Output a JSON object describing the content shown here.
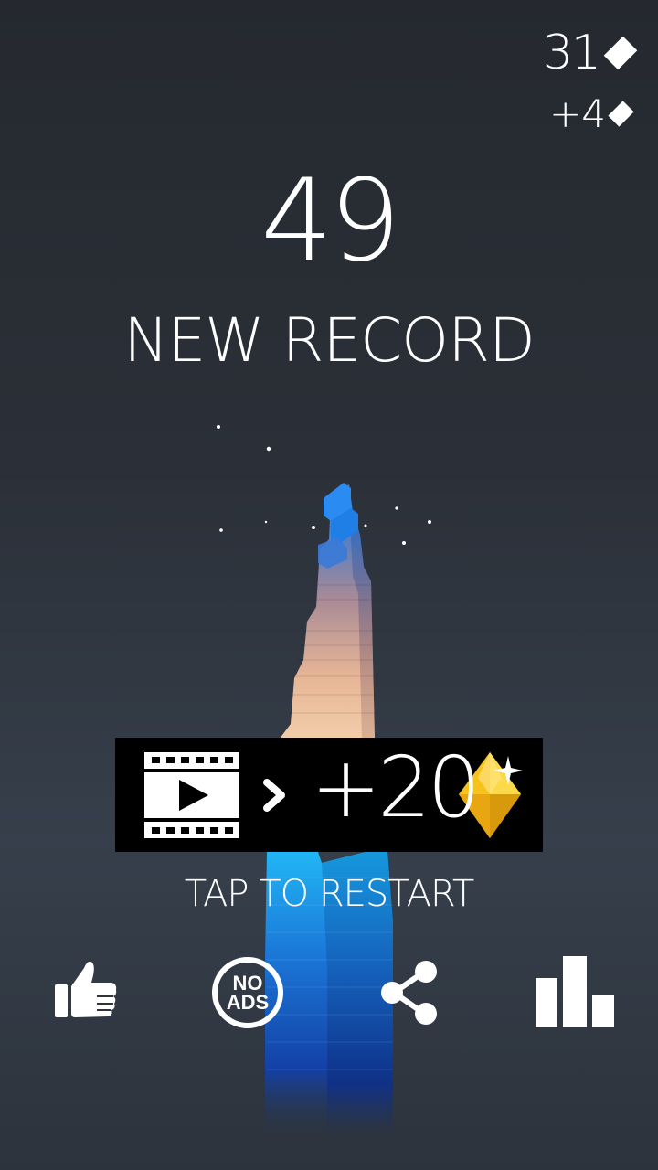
{
  "gems": {
    "total": "31",
    "gained": "+4"
  },
  "score": "49",
  "record_text": "NEW RECORD",
  "video_offer": {
    "reward": "+20",
    "play_icon": "film-play-icon",
    "arrow_icon": "chevron-right-icon",
    "gem_icon": "gold-gem-icon"
  },
  "restart_text": "TAP TO RESTART",
  "bottom_bar": {
    "rate_icon": "thumbs-up-icon",
    "no_ads": {
      "line1": "NO",
      "line2": "ADS"
    },
    "share_icon": "share-icon",
    "leaderboard_icon": "leaderboard-icon"
  },
  "colors": {
    "gem_gold": "#f6c21c",
    "tower_top_blue": "#1f86e6",
    "tower_glow_blue": "#1aa8f0",
    "banner_bg": "#000000"
  }
}
